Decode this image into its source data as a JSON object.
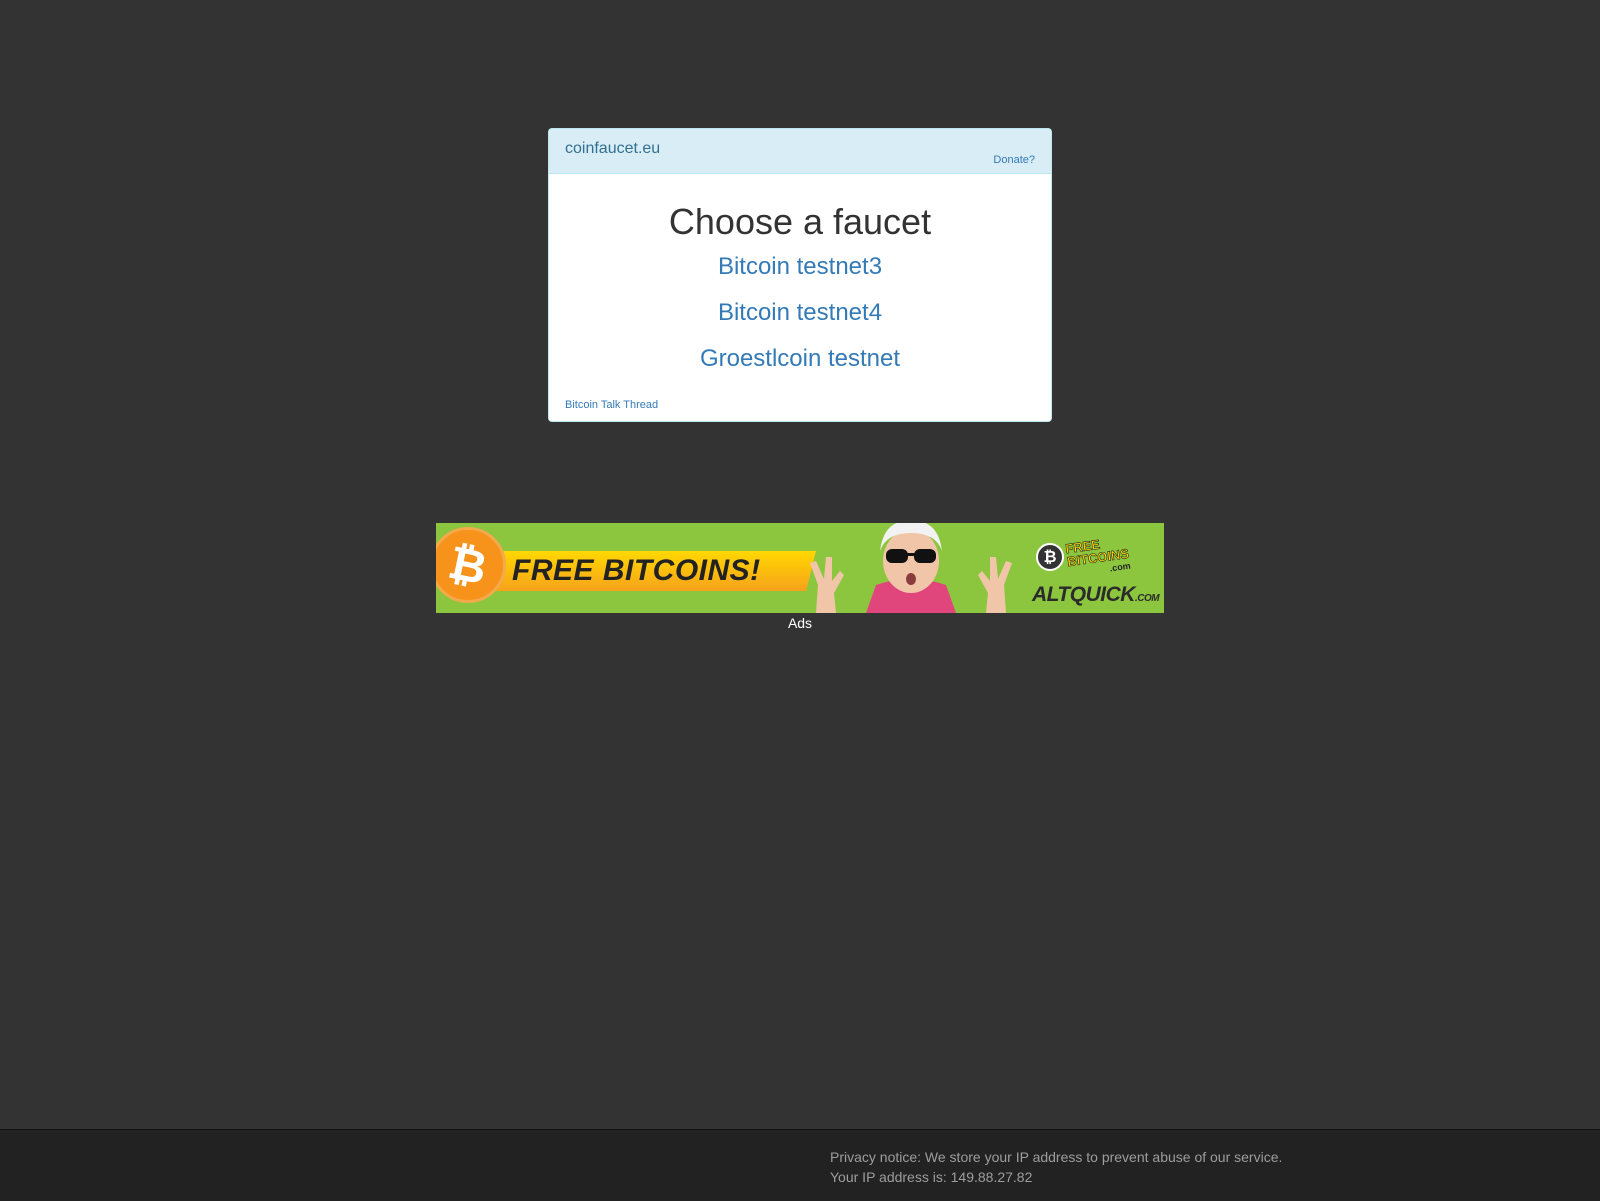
{
  "header": {
    "brand": "coinfaucet.eu",
    "donate_label": "Donate?"
  },
  "main": {
    "title": "Choose a faucet",
    "faucets": [
      {
        "label": "Bitcoin testnet3"
      },
      {
        "label": "Bitcoin testnet4"
      },
      {
        "label": "Groestlcoin testnet"
      }
    ],
    "talk_thread_label": "Bitcoin Talk Thread"
  },
  "ad": {
    "headline": "FREE BITCOINS!",
    "logo_line1": "FREE",
    "logo_line2": "BITCOINS",
    "logo_tld": ".com",
    "brand": "ALTQUICK",
    "brand_tld": ".COM",
    "caption": "Ads",
    "bitcoin_symbol": "₿"
  },
  "footer": {
    "privacy_notice": "Privacy notice: We store your IP address to prevent abuse of our service.",
    "ip_line": "Your IP address is: 149.88.27.82"
  },
  "colors": {
    "page_bg": "#333333",
    "panel_heading_bg": "#d9edf7",
    "link": "#337ab7",
    "ad_green": "#8cc63f",
    "bitcoin_orange": "#f7931a",
    "footer_bg": "#222222"
  }
}
